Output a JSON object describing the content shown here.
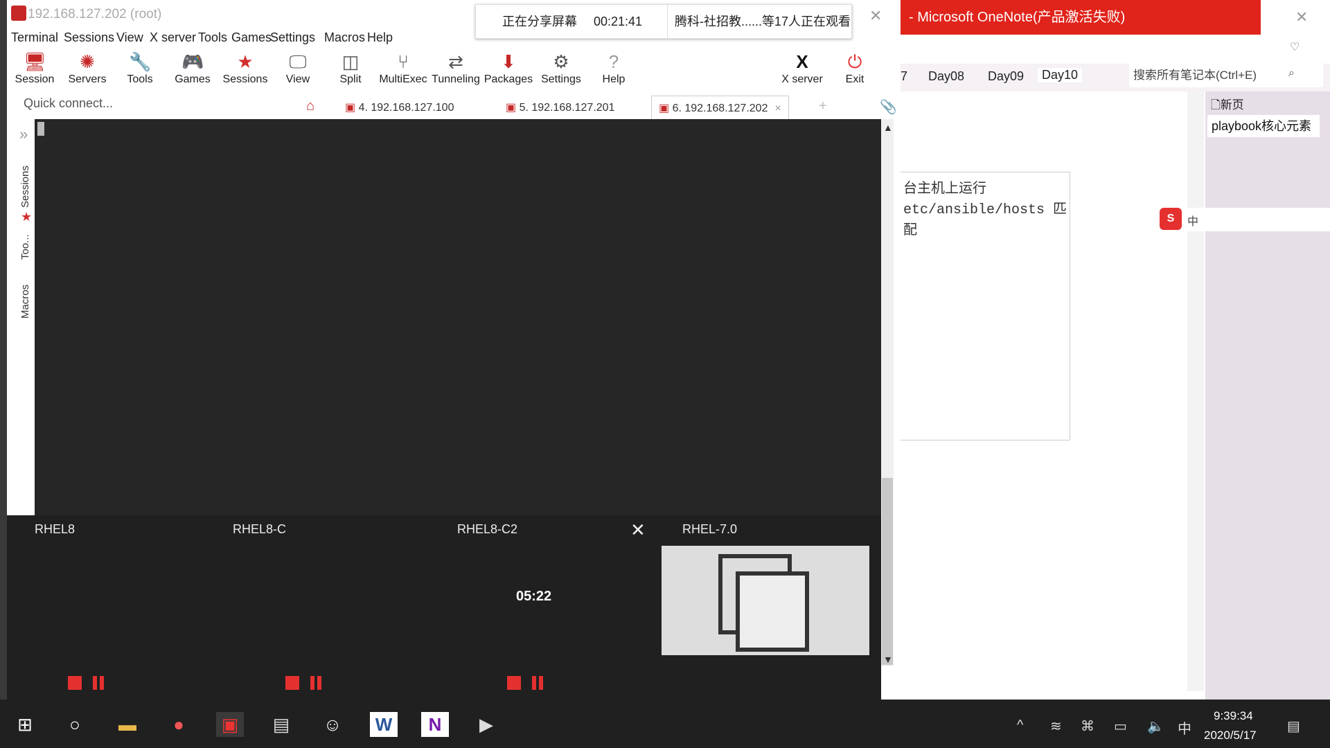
{
  "mobaxterm": {
    "title": "192.168.127.202 (root)",
    "menu": [
      "Terminal",
      "Sessions",
      "View",
      "X server",
      "Tools",
      "Games",
      "Settings",
      "Macros",
      "Help"
    ],
    "toolbar": [
      {
        "label": "Session",
        "icon": "session-icon"
      },
      {
        "label": "Servers",
        "icon": "servers-icon"
      },
      {
        "label": "Tools",
        "icon": "tools-icon"
      },
      {
        "label": "Games",
        "icon": "games-icon"
      },
      {
        "label": "Sessions",
        "icon": "star-icon"
      },
      {
        "label": "View",
        "icon": "view-icon"
      },
      {
        "label": "Split",
        "icon": "split-icon"
      },
      {
        "label": "MultiExec",
        "icon": "multiexec-icon"
      },
      {
        "label": "Tunneling",
        "icon": "tunneling-icon"
      },
      {
        "label": "Packages",
        "icon": "packages-icon"
      },
      {
        "label": "Settings",
        "icon": "settings-icon"
      },
      {
        "label": "Help",
        "icon": "help-icon"
      }
    ],
    "xserver_label": "X server",
    "exit_label": "Exit",
    "quick_connect_placeholder": "Quick connect...",
    "tabs": [
      "4. 192.168.127.100",
      "5. 192.168.127.201",
      "6. 192.168.127.202"
    ],
    "sidebar_tabs": [
      "Sessions",
      "Too...",
      "Macros"
    ]
  },
  "share_banner": {
    "status": "正在分享屏幕",
    "timer": "00:21:41",
    "viewers": "腾科-社招教......等17人正在观看"
  },
  "onenote": {
    "title": "- Microsoft OneNote(产品激活失败)",
    "tabs": [
      "7",
      "Day08",
      "Day09",
      "Day10"
    ],
    "search_placeholder": "搜索所有笔记本(Ctrl+E)",
    "new_page": "新页",
    "page_item": "playbook核心元素",
    "note_lines": [
      "台主机上运行",
      "etc/ansible/hosts 匹配"
    ]
  },
  "task_view": {
    "items": [
      "RHEL8",
      "RHEL8-C",
      "RHEL8-C2",
      "RHEL-7.0"
    ],
    "clock": "05:22"
  },
  "taskbar": {
    "time": "9:39:34",
    "date": "2020/5/17",
    "ime": "中"
  },
  "colors": {
    "onenote_red": "#e0241b",
    "terminal_bg": "#262626",
    "moba_red": "#d32f2f"
  }
}
